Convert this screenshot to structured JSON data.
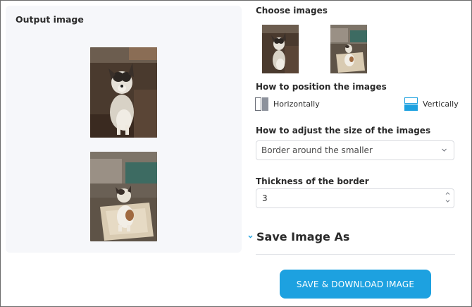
{
  "output": {
    "title": "Output image"
  },
  "choose": {
    "title": "Choose images"
  },
  "position": {
    "title": "How to position the images",
    "horizontal_label": "Horizontally",
    "vertical_label": "Vertically",
    "selected": "Vertically",
    "accent_color": "#1da1e0"
  },
  "size": {
    "title": "How to adjust the size of the images",
    "selected_value": "Border around the smaller"
  },
  "border": {
    "title": "Thickness of the border",
    "value": "3"
  },
  "save_as": {
    "label": "Save Image As"
  },
  "download": {
    "label": "SAVE & DOWNLOAD IMAGE",
    "color": "#1da1e0"
  }
}
